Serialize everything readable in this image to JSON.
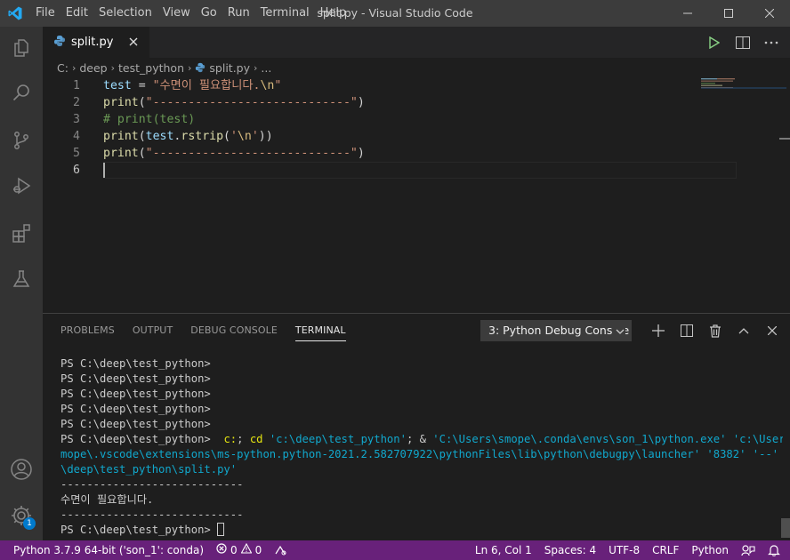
{
  "window": {
    "title": "split.py - Visual Studio Code",
    "menu": [
      "File",
      "Edit",
      "Selection",
      "View",
      "Go",
      "Run",
      "Terminal",
      "Help"
    ]
  },
  "tabs": [
    {
      "label": "split.py",
      "icon": "python-file-icon"
    }
  ],
  "breadcrumb": [
    "C:",
    "deep",
    "test_python",
    "split.py",
    "..."
  ],
  "editor": {
    "line_numbers": [
      "1",
      "2",
      "3",
      "4",
      "5",
      "6"
    ],
    "active_line": "6",
    "lines": [
      [
        {
          "t": "test",
          "c": "var"
        },
        {
          "t": " = ",
          "c": "pl"
        },
        {
          "t": "\"수면이 필요합니다.",
          "c": "str"
        },
        {
          "t": "\\n",
          "c": "esc"
        },
        {
          "t": "\"",
          "c": "str"
        }
      ],
      [
        {
          "t": "print",
          "c": "fn"
        },
        {
          "t": "(",
          "c": "pl"
        },
        {
          "t": "\"----------------------------\"",
          "c": "str"
        },
        {
          "t": ")",
          "c": "pl"
        }
      ],
      [
        {
          "t": "# print(test)",
          "c": "cm"
        }
      ],
      [
        {
          "t": "print",
          "c": "fn"
        },
        {
          "t": "(",
          "c": "pl"
        },
        {
          "t": "test",
          "c": "var"
        },
        {
          "t": ".",
          "c": "pl"
        },
        {
          "t": "rstrip",
          "c": "fn"
        },
        {
          "t": "(",
          "c": "pl"
        },
        {
          "t": "'",
          "c": "str"
        },
        {
          "t": "\\n",
          "c": "esc"
        },
        {
          "t": "'",
          "c": "str"
        },
        {
          "t": "))",
          "c": "pl"
        }
      ],
      [
        {
          "t": "print",
          "c": "fn"
        },
        {
          "t": "(",
          "c": "pl"
        },
        {
          "t": "\"----------------------------\"",
          "c": "str"
        },
        {
          "t": ")",
          "c": "pl"
        }
      ],
      []
    ]
  },
  "panel": {
    "tabs": [
      "PROBLEMS",
      "OUTPUT",
      "DEBUG CONSOLE",
      "TERMINAL"
    ],
    "active_tab": "TERMINAL",
    "terminal_select": "3: Python Debug Console",
    "terminal_lines": [
      [
        {
          "t": "PS C:\\deep\\test_python>",
          "c": ""
        }
      ],
      [
        {
          "t": "PS C:\\deep\\test_python>",
          "c": ""
        }
      ],
      [
        {
          "t": "PS C:\\deep\\test_python>",
          "c": ""
        }
      ],
      [
        {
          "t": "PS C:\\deep\\test_python>",
          "c": ""
        }
      ],
      [
        {
          "t": "PS C:\\deep\\test_python>",
          "c": ""
        }
      ],
      [
        {
          "t": "PS C:\\deep\\test_python> ",
          "c": ""
        },
        {
          "t": " c:",
          "c": "y"
        },
        {
          "t": "; ",
          "c": ""
        },
        {
          "t": "cd",
          "c": "y"
        },
        {
          "t": " ",
          "c": ""
        },
        {
          "t": "'c:\\deep\\test_python'",
          "c": "c"
        },
        {
          "t": "; & ",
          "c": ""
        },
        {
          "t": "'C:\\Users\\smope\\.conda\\envs\\son_1\\python.exe'",
          "c": "c"
        },
        {
          "t": " ",
          "c": ""
        },
        {
          "t": "'c:\\Users\\s",
          "c": "c"
        }
      ],
      [
        {
          "t": "mope\\.vscode\\extensions\\ms-python.python-2021.2.582707922\\pythonFiles\\lib\\python\\debugpy\\launcher'",
          "c": "c"
        },
        {
          "t": " ",
          "c": ""
        },
        {
          "t": "'8382'",
          "c": "c"
        },
        {
          "t": " ",
          "c": ""
        },
        {
          "t": "'--'",
          "c": "c"
        },
        {
          "t": " ",
          "c": ""
        },
        {
          "t": "'c:",
          "c": "c"
        }
      ],
      [
        {
          "t": "\\deep\\test_python\\split.py'",
          "c": "c"
        }
      ],
      [
        {
          "t": "----------------------------",
          "c": ""
        }
      ],
      [
        {
          "t": "수면이 필요합니다.",
          "c": ""
        }
      ],
      [
        {
          "t": "----------------------------",
          "c": ""
        }
      ],
      [
        {
          "t": "PS C:\\deep\\test_python> ",
          "c": "",
          "cursor": true
        }
      ]
    ]
  },
  "activity": {
    "settings_badge": "1"
  },
  "statusbar": {
    "interpreter": "Python 3.7.9 64-bit ('son_1': conda)",
    "errors": "0",
    "warnings": "0",
    "position": "Ln 6, Col 1",
    "spaces": "Spaces: 4",
    "encoding": "UTF-8",
    "eol": "CRLF",
    "language": "Python"
  },
  "colors": {
    "statusbar": "#68217a",
    "accent": "#007acc"
  }
}
